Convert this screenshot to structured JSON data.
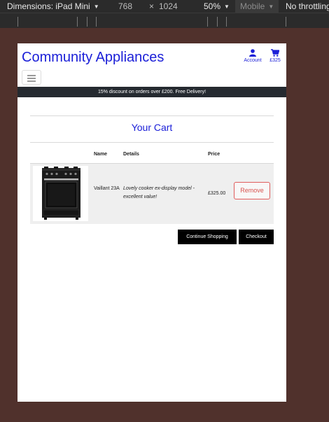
{
  "devtools": {
    "dimensions_label": "Dimensions: iPad Mini",
    "width": "768",
    "times": "×",
    "height": "1024",
    "zoom": "50%",
    "mode": "Mobile",
    "throttle": "No throttling"
  },
  "site": {
    "logo": "Community Appliances",
    "account_label": "Account",
    "bag_total": "£325",
    "promo": "15% discount on orders over £200. Free Delivery!"
  },
  "cart": {
    "title": "Your Cart",
    "columns": {
      "name": "Name",
      "details": "Details",
      "price": "Price"
    },
    "items": [
      {
        "name": "Vaillant 23A",
        "details": "Lovely cooker ex-display model - excellent value!",
        "price": "£325.00",
        "remove_label": "Remove"
      }
    ]
  },
  "actions": {
    "continue_label": "Continue Shopping",
    "checkout_label": "Checkout"
  },
  "colors": {
    "brand": "#1c20d8",
    "promo_bg": "#252a30",
    "remove": "#d9534f",
    "page_bg": "#50312c"
  }
}
